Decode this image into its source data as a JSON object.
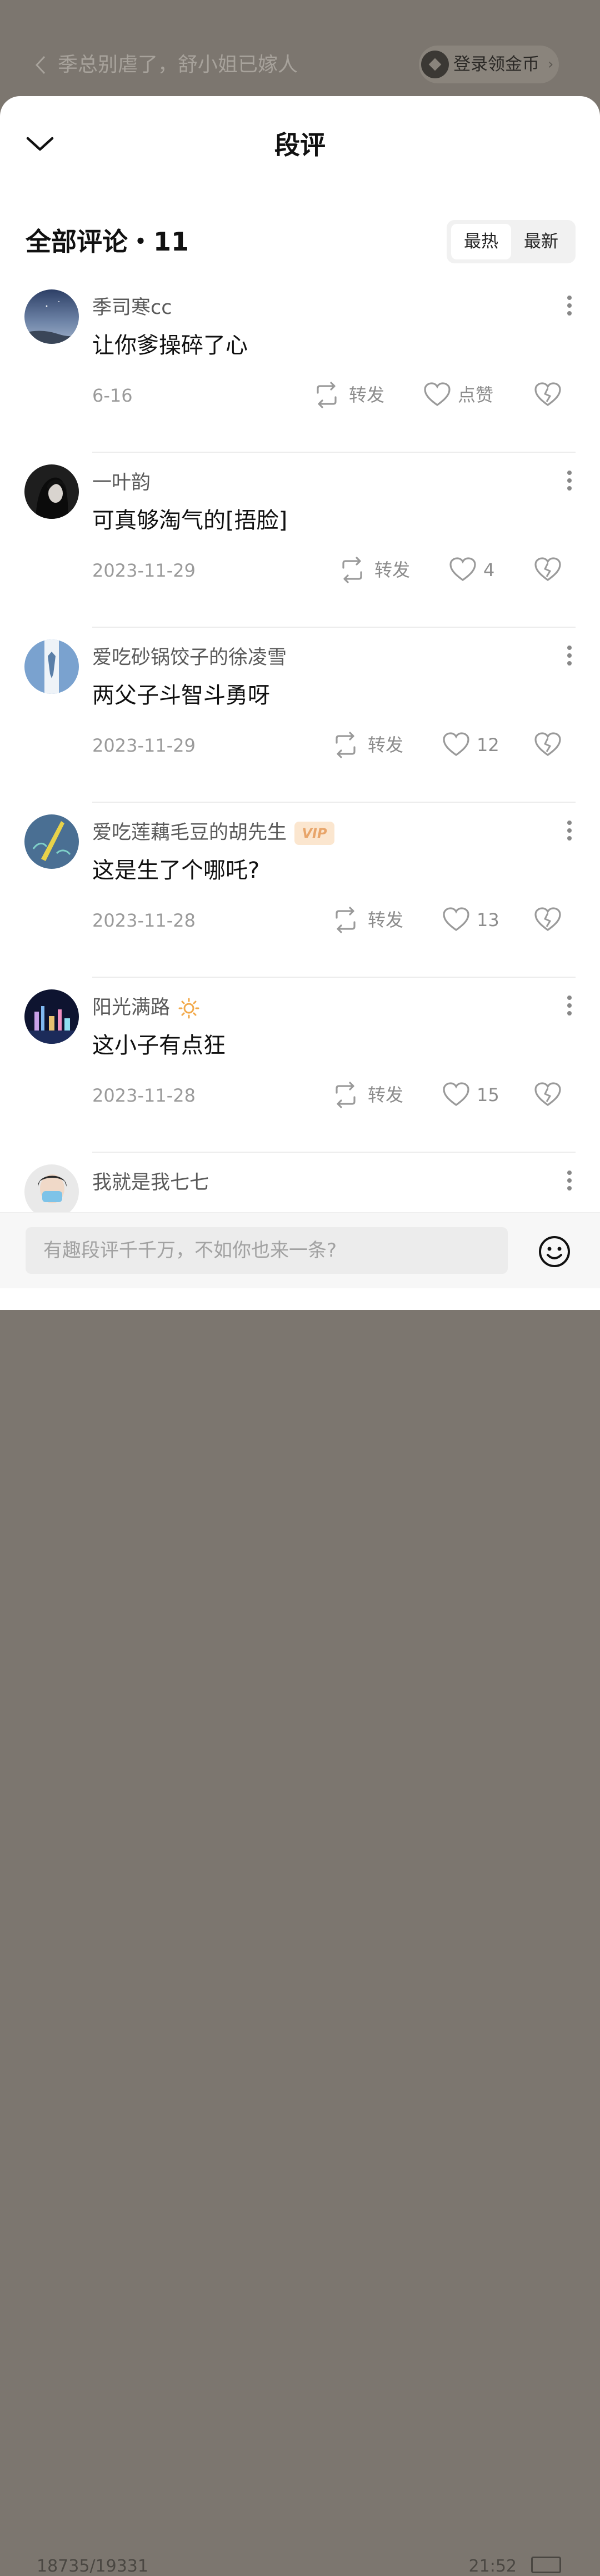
{
  "background": {
    "chapter_title": "季总别虐了，舒小姐已嫁人",
    "login_button": "登录领金币",
    "login_chevron": "›",
    "progress": "18735/19331",
    "clock": "21:52"
  },
  "sheet": {
    "title": "段评",
    "section_title": "全部评论・11",
    "sort": {
      "hot": "最热",
      "latest": "最新",
      "selected": "最热"
    }
  },
  "comments": [
    {
      "username": "季司寒cc",
      "badge": "",
      "text": "让你爹操碎了心",
      "date": "6-16",
      "share_label": "转发",
      "like_label": "点赞"
    },
    {
      "username": "一叶韵",
      "badge": "",
      "text": "可真够淘气的[捂脸]",
      "date": "2023-11-29",
      "share_label": "转发",
      "like_label": "4"
    },
    {
      "username": "爱吃砂锅饺子的徐凌雪",
      "badge": "",
      "text": "两父子斗智斗勇呀",
      "date": "2023-11-29",
      "share_label": "转发",
      "like_label": "12"
    },
    {
      "username": "爱吃莲藕毛豆的胡先生",
      "badge": "VIP",
      "text": "这是生了个哪吒?",
      "date": "2023-11-28",
      "share_label": "转发",
      "like_label": "13"
    },
    {
      "username": "阳光满路",
      "badge": "sun-icon",
      "text": "这小子有点狂",
      "date": "2023-11-28",
      "share_label": "转发",
      "like_label": "15"
    },
    {
      "username": "我就是我七七",
      "badge": "",
      "text": "",
      "date": "",
      "share_label": "",
      "like_label": ""
    }
  ],
  "input_bar": {
    "placeholder": "有趣段评千千万，不如你也来一条?",
    "emoji_icon": "smiley-icon"
  },
  "colors": {
    "vip_bg": "#fbe6cf",
    "vip_text": "#e8a56a",
    "sun": "#f2a94a",
    "overlay": "#7c766f"
  }
}
